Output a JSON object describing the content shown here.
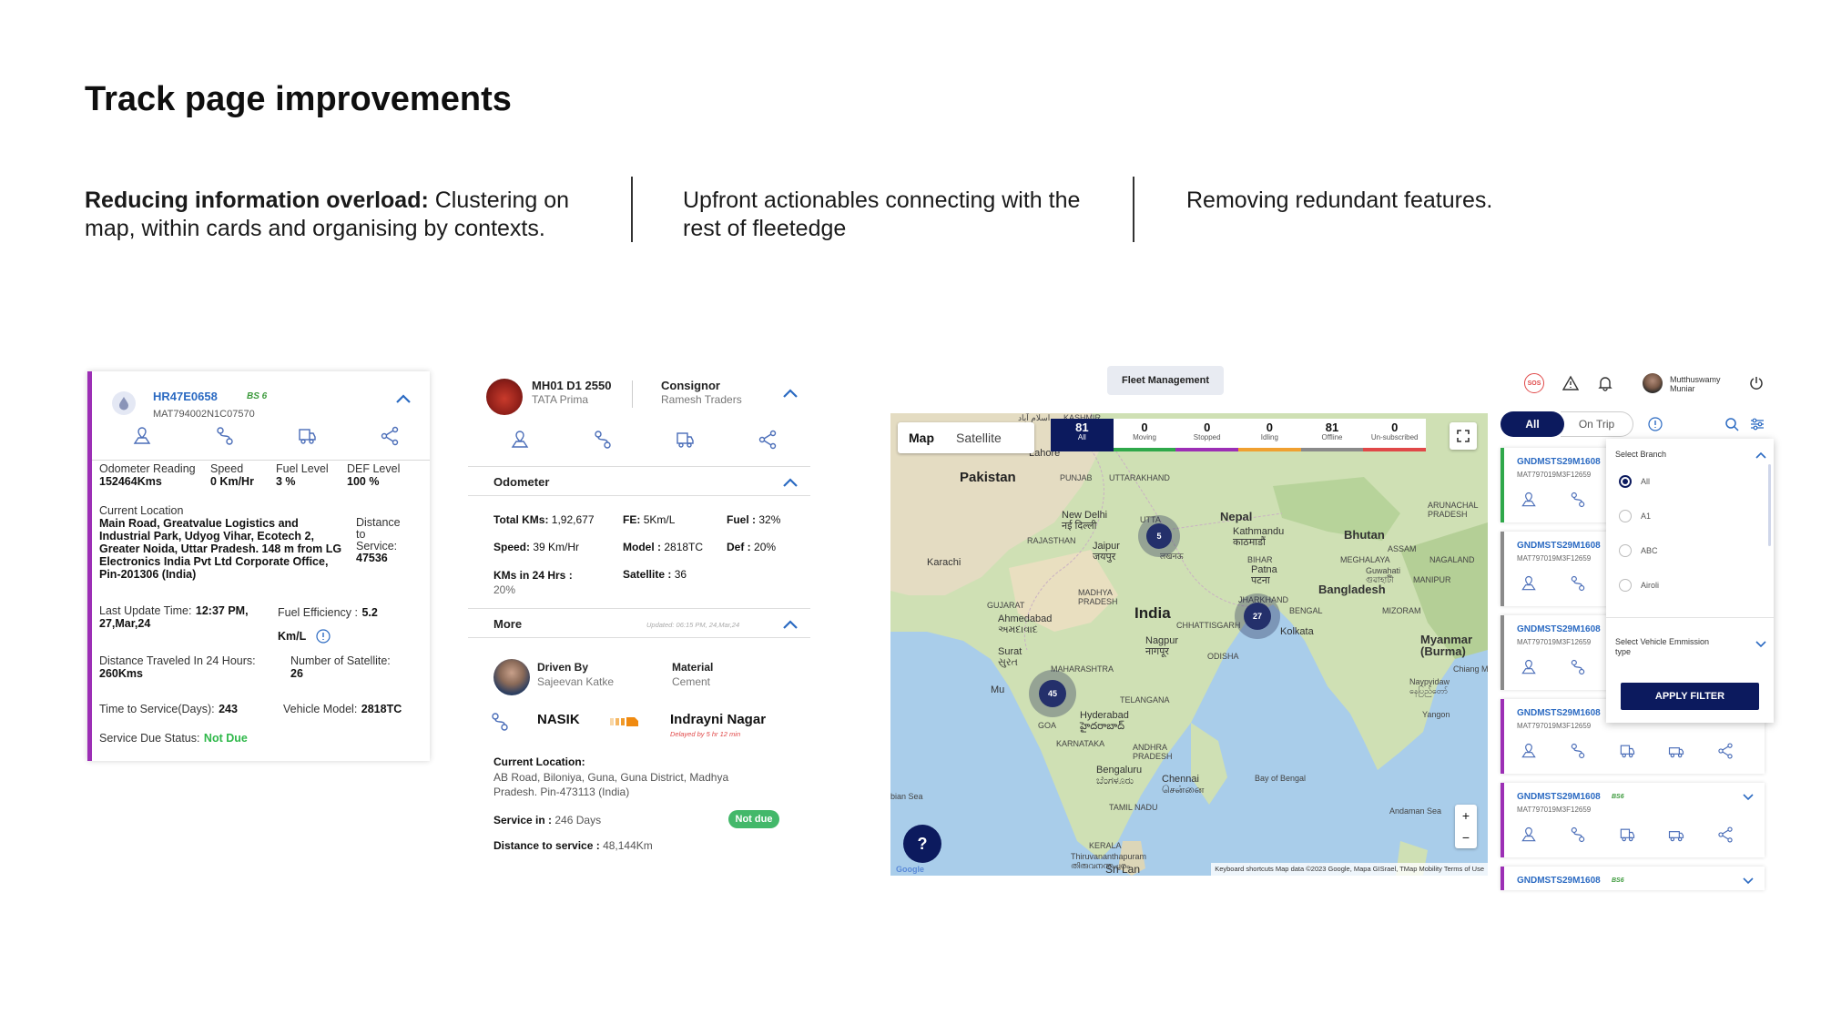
{
  "page": {
    "title": "Track page improvements",
    "col1_bold": "Reducing information overload:",
    "col1_rest": "Clustering on map, within cards and organising by contexts.",
    "col2": "Upfront actionables connecting with the rest of fleetedge",
    "col3": "Removing redundant features."
  },
  "card1": {
    "plate": "HR47E0658",
    "bs": "BS 6",
    "vin": "MAT794002N1C07570",
    "stats": [
      {
        "label": "Odometer Reading",
        "value": "152464Kms"
      },
      {
        "label": "Speed",
        "value": "0 Km/Hr"
      },
      {
        "label": "Fuel Level",
        "value": "3 %"
      },
      {
        "label": "DEF Level",
        "value": "100 %"
      }
    ],
    "location_label": "Current Location",
    "location_value": "Main Road, Greatvalue Logistics and Industrial Park, Udyog Vihar, Ecotech 2, Greater Noida, Uttar Pradesh. 148 m from LG Electronics India Pvt Ltd Corporate Office, Pin-201306 (India)",
    "distance_label_1": "Distance",
    "distance_label_2": "to",
    "distance_label_3": "Service:",
    "distance_value": "47536",
    "last_update_label": "Last Update Time:",
    "last_update_value_1": "12:37 PM,",
    "last_update_value_2": "27,Mar,24",
    "fuel_eff_label": "Fuel Efficiency :",
    "fuel_eff_value": "5.2",
    "fuel_eff_unit": "Km/L",
    "dist24_label": "Distance Traveled In 24 Hours:",
    "dist24_value": "260Kms",
    "satellite_label": "Number of Satellite:",
    "satellite_value": "26",
    "tts_label": "Time to Service(Days):",
    "tts_value": "243",
    "model_label": "Vehicle Model:",
    "model_value": "2818TC",
    "service_label": "Service Due Status:",
    "service_value": "Not Due"
  },
  "card2": {
    "plate": "MH01 D1 2550",
    "model": "TATA Prima",
    "consignor_label": "Consignor",
    "consignor_value": "Ramesh Traders",
    "odometer_label": "Odometer",
    "total_kms_label": "Total KMs:",
    "total_kms_value": "1,92,677",
    "fe_label": "FE:",
    "fe_value": "5Km/L",
    "fuel_label": "Fuel :",
    "fuel_value": "32%",
    "speed_label": "Speed:",
    "speed_value": "39 Km/Hr",
    "model_label": "Model :",
    "model_value": "2818TC",
    "def_label": "Def :",
    "def_value": "20%",
    "kms24_label": "KMs in 24 Hrs :",
    "kms24_value": "20%",
    "satellite_label": "Satellite :",
    "satellite_value": "36",
    "more_label": "More",
    "updated": "Updated: 06:15 PM, 24,Mar,24",
    "driven_by_label": "Driven By",
    "driver_name": "Sajeevan Katke",
    "material_label": "Material",
    "material_value": "Cement",
    "from": "NASIK",
    "to": "Indrayni Nagar",
    "delay": "Delayed by 5 hr 12 min",
    "current_location_label": "Current Location:",
    "current_location_value": "AB Road, Biloniya, Guna, Guna District, Madhya Pradesh. Pin-473113 (India)",
    "service_in_label": "Service in :",
    "service_in_value": "246 Days",
    "not_due": "Not due",
    "distance_service_label": "Distance to service :",
    "distance_service_value": "48,144Km"
  },
  "app": {
    "fleet_tag": "Fleet Management",
    "sos": "SOS",
    "user_first": "Mutthuswamy",
    "user_last": "Muniar",
    "map_tab": "Map",
    "satellite_tab": "Satellite",
    "status": [
      {
        "count": "81",
        "label": "All",
        "color": "#0c1a5e"
      },
      {
        "count": "0",
        "label": "Moving",
        "color": "#2fa84a"
      },
      {
        "count": "0",
        "label": "Stopped",
        "color": "#9c2fb5"
      },
      {
        "count": "0",
        "label": "Idling",
        "color": "#f0a030"
      },
      {
        "count": "81",
        "label": "Offline",
        "color": "#8a8a8a"
      },
      {
        "count": "0",
        "label": "Un-subscribed",
        "color": "#e04848"
      }
    ],
    "clusters": [
      {
        "n": "5"
      },
      {
        "n": "27"
      },
      {
        "n": "45"
      }
    ],
    "map_labels": {
      "pakistan": "Pakistan",
      "india": "India",
      "nepal": "Nepal",
      "bhutan": "Bhutan",
      "bangladesh": "Bangladesh",
      "myanmar": "Myanmar (Burma)",
      "karachi": "Karachi",
      "newdelhi": "New Delhi",
      "newdelhi_local": "नई दिल्ली",
      "jaipur": "Jaipur",
      "jaipur_local": "जयपुर",
      "lucknow_local": "लखनऊ",
      "kathmandu": "Kathmandu",
      "kathmandu_local": "काठमाडौं",
      "patna": "Patna",
      "patna_local": "पटना",
      "ahmedabad": "Ahmedabad",
      "ahmedabad_local": "અમદાવાદ",
      "surat": "Surat",
      "surat_local": "સુરત",
      "nagpur": "Nagpur",
      "nagpur_local": "नागपूर",
      "kolkata": "Kolkata",
      "hyderabad": "Hyderabad",
      "hyderabad_local": "హైదరాబాద్",
      "bengaluru": "Bengaluru",
      "bengaluru_local": "ಬೆಂಗಳೂರು",
      "chennai": "Chennai",
      "chennai_local": "சென்னை",
      "thiruvananthapuram": "Thiruvananthapuram",
      "thiruvananthapuram_local": "തിരുവനന്തപുരം",
      "bayofbengal": "Bay of Bengal",
      "andaman": "Andaman Sea",
      "arabian": "bian Sea",
      "mumbai": "Mu",
      "srilanka": "Sri Lan",
      "rajasthan": "RAJASTHAN",
      "punjab": "PUNJAB",
      "uttarakhand": "UTTARAKHAND",
      "madhya": "MADHYA",
      "pradesh": "PRADESH",
      "gujarat": "GUJARAT",
      "maharashtra": "MAHARASHTRA",
      "telangana": "TELANGANA",
      "karnataka": "KARNATAKA",
      "andhra": "ANDHRA",
      "andhra2": "PRADESH",
      "tamilnadu": "TAMIL NADU",
      "kerala": "KERALA",
      "odisha": "ODISHA",
      "chhattisgarh": "CHHATTISGARH",
      "jharkhand": "JHARKHAND",
      "bihar": "BIHAR",
      "assam": "ASSAM",
      "meghalaya": "MEGHALAYA",
      "nagaland": "NAGALAND",
      "manipur": "MANIPUR",
      "mizoram": "MIZORAM",
      "arunachal": "ARUNACHAL",
      "arunachal2": "PRADESH",
      "utta": "UTTA",
      "bengal": "BENGAL",
      "goa": "GOA",
      "lahore": "Lahore",
      "kashmir": "KASHMIR",
      "islamabad": "اسلام آباد",
      "guwahati": "Guwahati",
      "guwahati_local": "গুৱাহাটী",
      "chiang": "Chiang Ma",
      "naypyidaw": "Naypyidaw",
      "naypyidaw_local": "နေပြည်တော်",
      "yangon": "Yangon"
    },
    "attribution": "Keyboard shortcuts   Map data ©2023 Google, Mapa GISrael, TMap Mobility   Terms of Use",
    "google": "Google",
    "all_tab": "All",
    "ontrip_tab": "On Trip",
    "vehicles": [
      {
        "plate": "GNDMSTS29M1608",
        "vin": "MAT797019M3F12659",
        "color": "#2fa84a"
      },
      {
        "plate": "GNDMSTS29M1608",
        "vin": "MAT797019M3F12659",
        "color": "#8a8a8a"
      },
      {
        "plate": "GNDMSTS29M1608",
        "vin": "MAT797019M3F12659",
        "color": "#8a8a8a"
      },
      {
        "plate": "GNDMSTS29M1608",
        "vin": "MAT797019M3F12659",
        "color": "#9c2fb5"
      },
      {
        "plate": "GNDMSTS29M1608",
        "vin": "MAT797019M3F12659",
        "color": "#9c2fb5"
      },
      {
        "plate": "GNDMSTS29M1608",
        "vin": "",
        "color": "#9c2fb5"
      }
    ],
    "bs_tag": "BS6",
    "filter": {
      "branch_label": "Select Branch",
      "options": [
        "All",
        "A1",
        "ABC",
        "Airoli"
      ],
      "emission_label_1": "Select Vehicle Emmission",
      "emission_label_2": "type",
      "apply": "APPLY FILTER"
    }
  }
}
